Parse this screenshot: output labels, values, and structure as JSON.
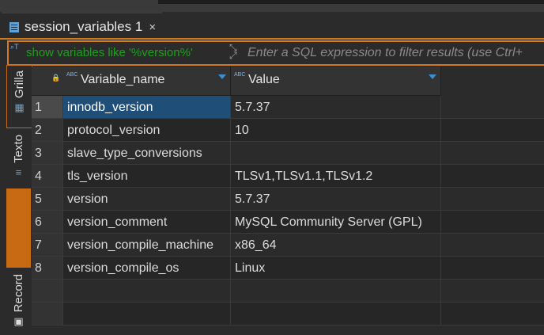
{
  "tab": {
    "label": "session_variables 1",
    "close": "×"
  },
  "filter": {
    "query": "show variables like '%version%'",
    "placeholder": "Enter a SQL expression to filter results (use Ctrl+"
  },
  "side_tabs": {
    "grid": "Grilla",
    "text": "Texto",
    "record": "Record"
  },
  "columns": [
    "Variable_name",
    "Value"
  ],
  "rows": [
    {
      "num": "1",
      "name": "innodb_version",
      "value": "5.7.37"
    },
    {
      "num": "2",
      "name": "protocol_version",
      "value": "10"
    },
    {
      "num": "3",
      "name": "slave_type_conversions",
      "value": ""
    },
    {
      "num": "4",
      "name": "tls_version",
      "value": "TLSv1,TLSv1.1,TLSv1.2"
    },
    {
      "num": "5",
      "name": "version",
      "value": "5.7.37"
    },
    {
      "num": "6",
      "name": "version_comment",
      "value": "MySQL Community Server (GPL)"
    },
    {
      "num": "7",
      "name": "version_compile_machine",
      "value": "x86_64"
    },
    {
      "num": "8",
      "name": "version_compile_os",
      "value": "Linux"
    }
  ],
  "colors": {
    "accent": "#d27a1a",
    "selection": "#1f4e79",
    "icon": "#5fa3d8"
  }
}
